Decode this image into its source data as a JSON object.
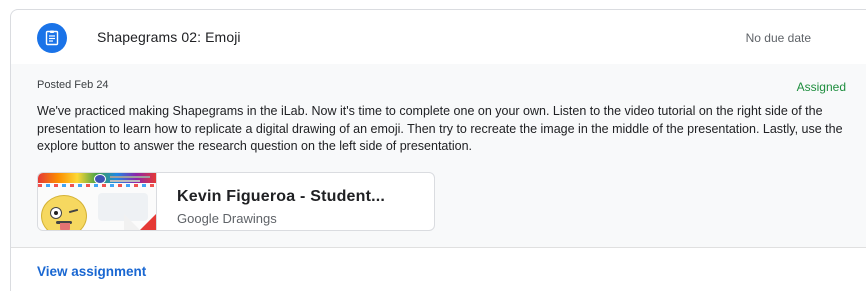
{
  "assignment": {
    "icon": "assignment-icon",
    "title": "Shapegrams 02: Emoji",
    "due": "No due date"
  },
  "details": {
    "posted": "Posted Feb 24",
    "status": "Assigned",
    "description": "We've practiced making Shapegrams in the iLab. Now it's time to complete one on your own. Listen to the video tutorial on the right side of the presentation to learn how to replicate a digital drawing of an emoji. Then try to recreate the image in the middle of the presentation. Lastly, use the explore button to answer the research question on the left side of presentation."
  },
  "attachment": {
    "title": "Kevin Figueroa - Student...",
    "type": "Google Drawings",
    "thumbnail": "emoji-drawing-thumbnail"
  },
  "footer": {
    "view_link": "View assignment"
  },
  "colors": {
    "accent": "#1a73e8",
    "status": "#1e8e3e",
    "link": "#1967d2"
  }
}
